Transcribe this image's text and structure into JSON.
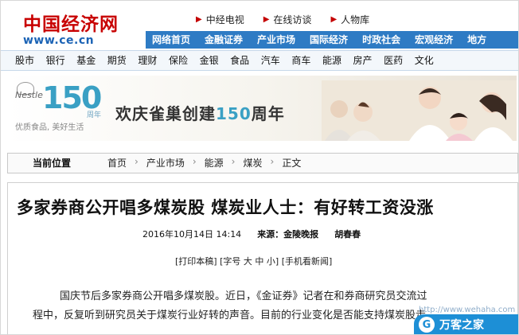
{
  "logo": {
    "cn": "中国经济网",
    "url": "www.ce.cn"
  },
  "top_links": [
    "中经电视",
    "在线访谈",
    "人物库"
  ],
  "blue_tabs": [
    "网络首页",
    "金融证券",
    "产业市场",
    "国际经济",
    "时政社会",
    "宏观经济",
    "地方"
  ],
  "categories": [
    "股市",
    "银行",
    "基金",
    "期货",
    "理财",
    "保险",
    "金银",
    "食品",
    "汽车",
    "商车",
    "能源",
    "房产",
    "医药",
    "文化"
  ],
  "banner": {
    "brand": "Nestle",
    "number": "150",
    "zhounian": "周年",
    "slogan": "优质食品, 美好生活",
    "promo_prefix": "欢庆雀巢创建",
    "promo_number": "150",
    "promo_suffix": "周年"
  },
  "location": {
    "label": "当前位置",
    "crumbs": [
      "首页",
      "产业市场",
      "能源",
      "煤炭",
      "正文"
    ],
    "sep": "›"
  },
  "article": {
    "headline": "多家券商公开唱多煤炭股 煤炭业人士：有好转工资没涨",
    "datetime": "2016年10月14日 14:14",
    "source": "来源：金陵晚报",
    "author": "胡春春",
    "tools": {
      "print": "[打印本稿]",
      "font_prefix": "[字号",
      "big": "大",
      "mid": "中",
      "small": "小]",
      "mobile": "[手机看新闻]"
    },
    "line1": "国庆节后多家券商公开唱多煤炭股。近日，《金证券》记者在和券商研究员交流过",
    "line2": "程中，反复听到研究员关于煤炭行业好转的声音。目前的行业变化是否能支持煤炭股走"
  },
  "watermark": {
    "url": "http://www.wehaha.com",
    "badge_text": "万客之家",
    "badge_icon": "G"
  },
  "colors": {
    "brand_red": "#c80000",
    "nav_blue": "#2e7bc4",
    "accent_teal": "#3aa0c4",
    "watermark_blue": "#1d8fd6"
  }
}
